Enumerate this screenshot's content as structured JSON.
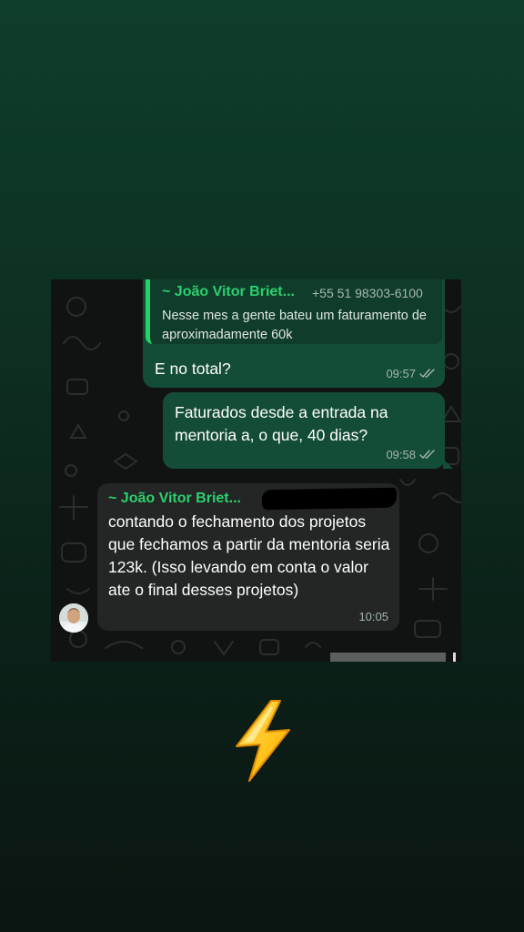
{
  "chat": {
    "messages": [
      {
        "direction": "outgoing",
        "quoted": {
          "sender": "~ João Vitor Briet...",
          "phone": "+55 51 98303-6100",
          "text": "Nesse mes a gente bateu um faturamento de aproximadamente 60k"
        },
        "text": "E no total?",
        "time": "09:57",
        "status": "read"
      },
      {
        "direction": "outgoing",
        "text": "Faturados desde a entrada na mentoria a, o que, 40 dias?",
        "time": "09:58",
        "status": "read"
      },
      {
        "direction": "incoming",
        "sender": "~ João Vitor Briet...",
        "text": "contando o fechamento dos projetos que fechamos a partir da mentoria seria 123k. (Isso levando em conta o valor ate o final desses projetos)",
        "time": "10:05"
      }
    ]
  },
  "colors": {
    "outgoing_bubble": "#144d37",
    "incoming_bubble": "#232625",
    "sender_name": "#2cd06e",
    "quote_bar": "#25d366",
    "read_check": "#a5b5ad"
  },
  "icons": {
    "read_receipt": "double-check-icon",
    "sticker": "lightning-bolt-icon"
  }
}
